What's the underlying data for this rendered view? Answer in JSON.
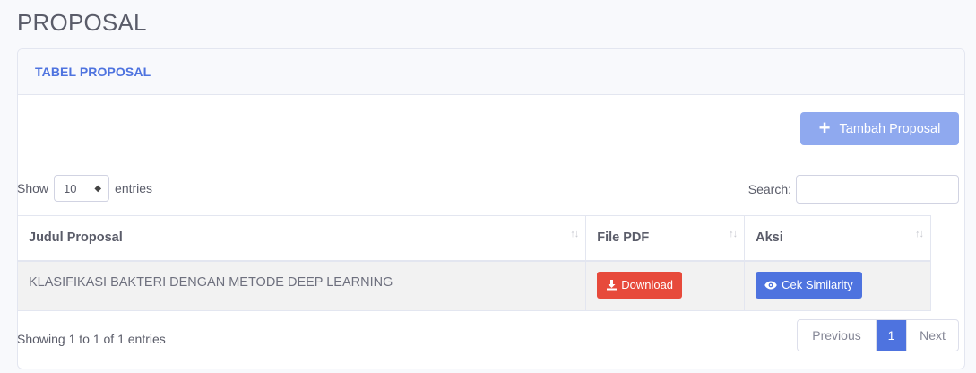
{
  "page": {
    "title": "PROPOSAL"
  },
  "card": {
    "header_title": "TABEL PROPOSAL",
    "add_button_label": "Tambah Proposal"
  },
  "controls": {
    "show_label": "Show",
    "entries_value": "10",
    "entries_label": "entries",
    "search_label": "Search:",
    "search_value": ""
  },
  "table": {
    "columns": [
      "Judul Proposal",
      "File PDF",
      "Aksi"
    ],
    "rows": [
      {
        "title": "KLASIFIKASI BAKTERI DENGAN METODE DEEP LEARNING",
        "download_label": "Download",
        "similarity_label": "Cek Similarity"
      }
    ]
  },
  "footer": {
    "info": "Showing 1 to 1 of 1 entries",
    "prev_label": "Previous",
    "current_page": "1",
    "next_label": "Next"
  },
  "colors": {
    "primary": "#4e73df",
    "danger": "#e74a3b",
    "add_button": "#8fa9ef"
  }
}
